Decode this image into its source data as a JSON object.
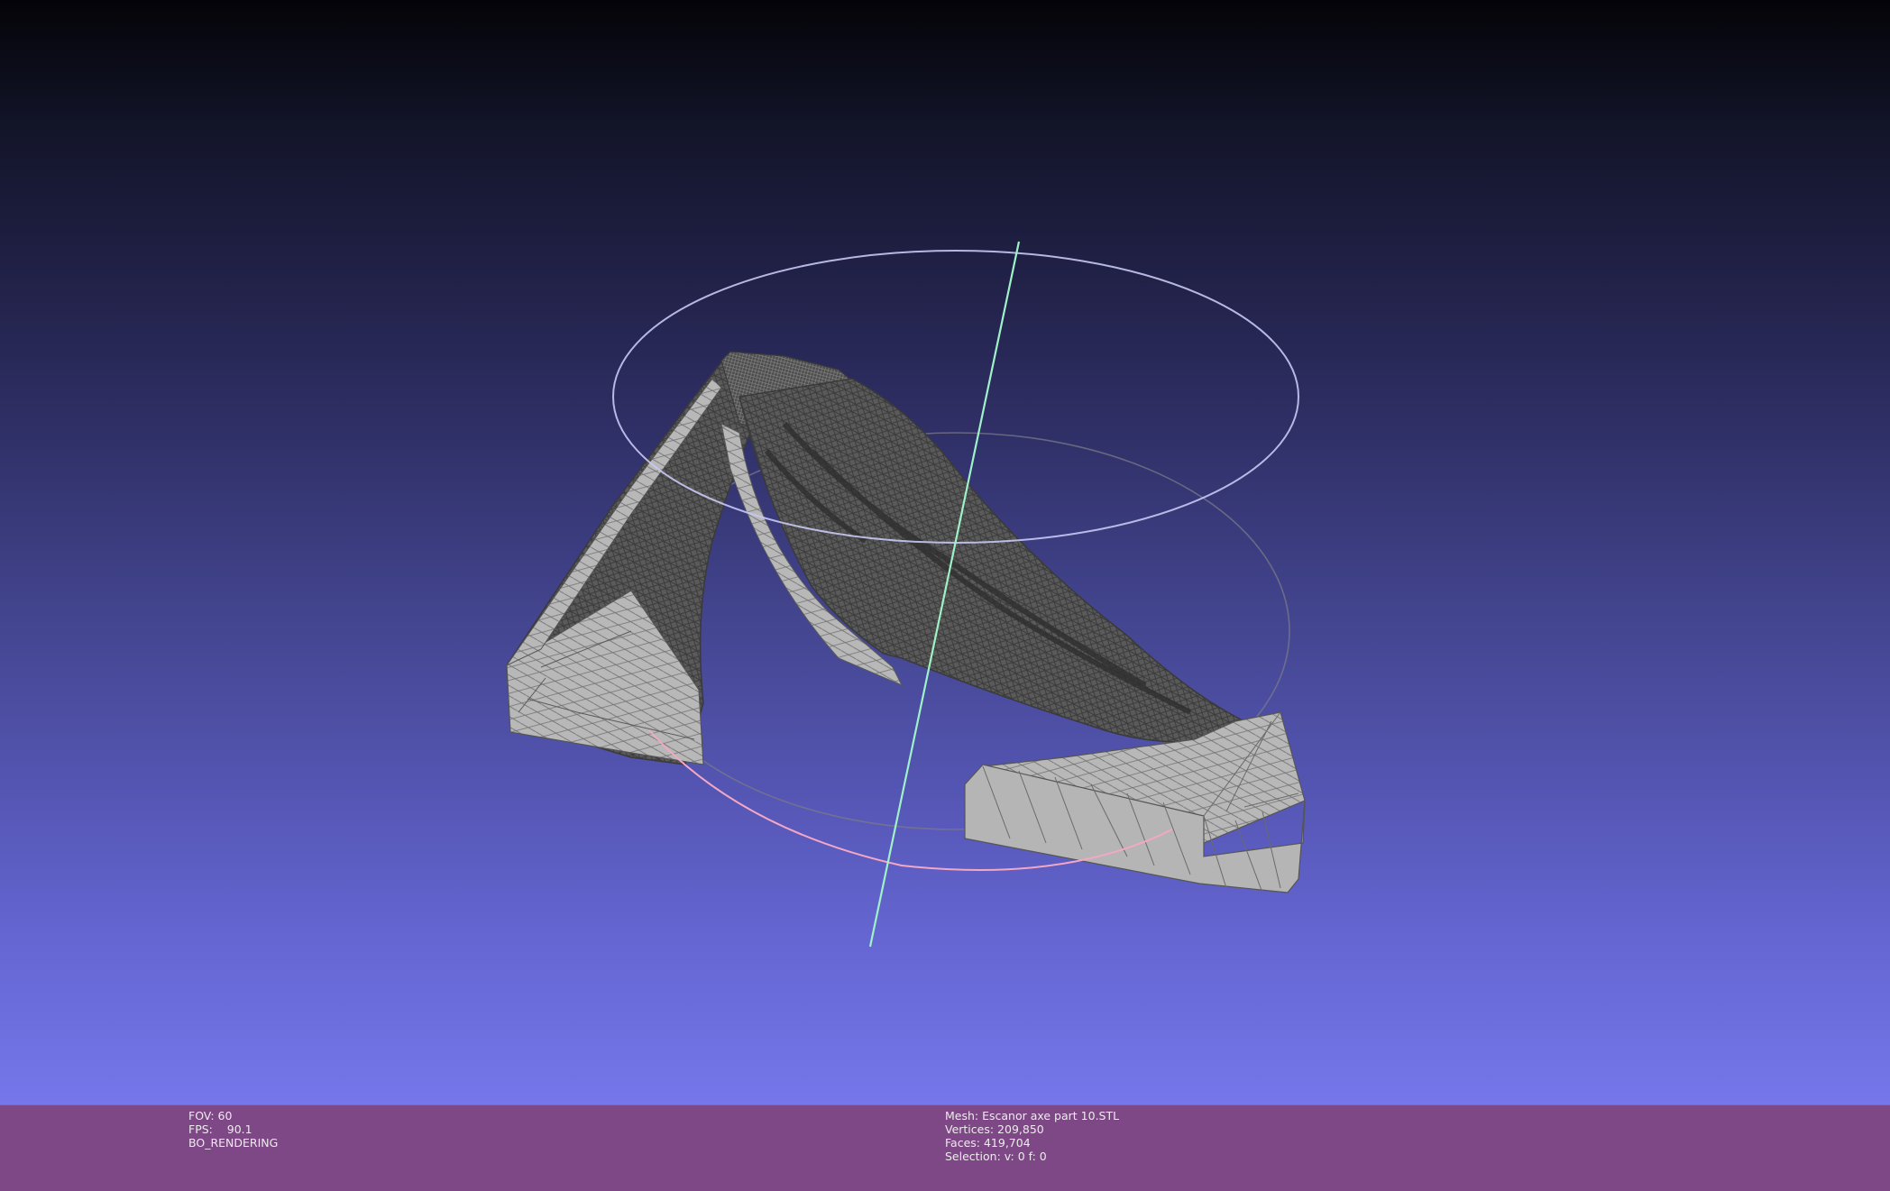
{
  "left_info": {
    "fov": "FOV: 60",
    "fps": "FPS:    90.1",
    "mode": "BO_RENDERING"
  },
  "right_info": {
    "mesh": "Mesh: Escanor axe part 10.STL",
    "vertices": "Vertices: 209,850",
    "faces": "Faces: 419,704",
    "selection": "Selection: v: 0 f: 0"
  },
  "colors": {
    "statusbar": "#7e4886",
    "mesh_face": "#b9b9b9",
    "mesh_wire": "#4a4a4a",
    "trackball_x": "#f3a7c4",
    "trackball_y": "#c8c8f4",
    "trackball_axis": "#9ff2c8",
    "trackball_gray": "#888888"
  }
}
